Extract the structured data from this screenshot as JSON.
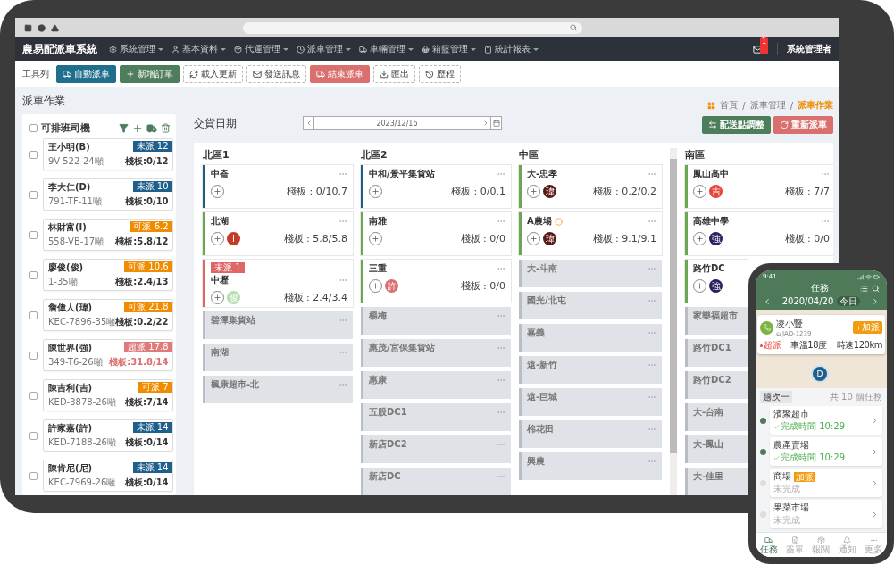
{
  "app": {
    "title": "農易配派車系統",
    "menu": [
      {
        "label": "系統管理"
      },
      {
        "label": "基本資料"
      },
      {
        "label": "代運管理"
      },
      {
        "label": "派車管理"
      },
      {
        "label": "車輛管理"
      },
      {
        "label": "箱籃管理"
      },
      {
        "label": "統計報表"
      }
    ],
    "notifications": "1",
    "user": "系統管理者"
  },
  "toolbar": {
    "label": "工具列",
    "buttons": [
      {
        "label": "自動派車",
        "kind": "primary"
      },
      {
        "label": "新增訂單",
        "kind": "success"
      },
      {
        "label": "載入更新",
        "kind": "outline"
      },
      {
        "label": "發送訊息",
        "kind": "outline"
      },
      {
        "label": "結束派車",
        "kind": "danger"
      },
      {
        "label": "匯出",
        "kind": "outline"
      },
      {
        "label": "歷程",
        "kind": "outline"
      }
    ]
  },
  "page": {
    "title": "派車作業",
    "breadcrumb": [
      {
        "label": "首頁",
        "selected": false
      },
      {
        "label": "派車管理",
        "selected": false
      },
      {
        "label": "派車作業",
        "selected": true
      }
    ],
    "breadcrumb_separators": [
      "/",
      "/"
    ]
  },
  "drivers": {
    "title": "可排班司機",
    "checked": false,
    "items": [
      {
        "name": "王小明(B)",
        "plate": "9V-522-24噸",
        "badge": "未派 12",
        "kind": "unassigned",
        "load": "棧板:0/12",
        "checked": false
      },
      {
        "name": "李大仁(D)",
        "plate": "791-TF-11噸",
        "badge": "未派 10",
        "kind": "unassigned",
        "load": "棧板:0/10",
        "checked": false
      },
      {
        "name": "林財富(I)",
        "plate": "558-VB-17噸",
        "badge": "可派 6.2",
        "kind": "available",
        "load": "棧板:5.8/12",
        "checked": false
      },
      {
        "name": "廖俊(俊)",
        "plate": "1-35噸",
        "badge": "可派 10.6",
        "kind": "available",
        "load": "棧板:2.4/13",
        "checked": false
      },
      {
        "name": "詹偉人(瑋)",
        "plate": "KEC-7896-35噸",
        "badge": "可派 21.8",
        "kind": "available",
        "load": "棧板:0.2/22",
        "checked": false
      },
      {
        "name": "陳世界(強)",
        "plate": "349-T6-26噸",
        "badge": "超派 17.8",
        "kind": "over",
        "load": "棧板:31.8/14",
        "checked": false
      },
      {
        "name": "陳吉利(吉)",
        "plate": "KED-3878-26噸",
        "badge": "可派 7",
        "kind": "available",
        "load": "棧板:7/14",
        "checked": false
      },
      {
        "name": "許家嘉(許)",
        "plate": "KED-7188-26噸",
        "badge": "未派 14",
        "kind": "unassigned",
        "load": "棧板:0/14",
        "checked": false
      },
      {
        "name": "陳肯尼(尼)",
        "plate": "KEC-7969-26噸",
        "badge": "未派 14",
        "kind": "unassigned",
        "load": "棧板:0/14",
        "checked": false
      }
    ]
  },
  "board": {
    "date_label": "交貨日期",
    "date": "2023/12/16",
    "actions": [
      {
        "label": "配送點調整",
        "kind": "success"
      },
      {
        "label": "重新派車",
        "kind": "danger"
      }
    ],
    "columns": [
      {
        "name": "北區1",
        "stops": [
          {
            "name": "中崙",
            "kind": "active",
            "color": "#1f5f8b",
            "load": "棧板 : 0/10.7"
          },
          {
            "name": "北湖",
            "kind": "active",
            "color": "#6aa84f",
            "chips": [
              {
                "label": "I",
                "color": "#c53a26"
              }
            ],
            "load": "棧板 : 5.8/5.8"
          },
          {
            "name": "中壢",
            "kind": "active",
            "color": "#e06666",
            "tag": "未派 1",
            "chips": [
              {
                "label": "俊",
                "color": "#b6e0b0"
              }
            ],
            "load": "棧板 : 2.4/3.4"
          },
          {
            "name": "碧潭集貨站",
            "kind": "idle"
          },
          {
            "name": "南湖",
            "kind": "idle"
          },
          {
            "name": "楓康超市-北",
            "kind": "idle"
          }
        ]
      },
      {
        "name": "北區2",
        "stops": [
          {
            "name": "中和/景平集貨站",
            "kind": "active",
            "color": "#1f5f8b",
            "load": "棧板 : 0/0.1"
          },
          {
            "name": "南雅",
            "kind": "active",
            "color": "#6aa84f",
            "load": "棧板 : 0/0"
          },
          {
            "name": "三重",
            "kind": "active",
            "color": "#6aa84f",
            "chips": [
              {
                "label": "許",
                "color": "#d9706e"
              }
            ],
            "load": "棧板 : 0/0"
          },
          {
            "name": "楊梅",
            "kind": "idle"
          },
          {
            "name": "惠茂/宮保集貨站",
            "kind": "idle"
          },
          {
            "name": "惠康",
            "kind": "idle"
          },
          {
            "name": "五股DC1",
            "kind": "idle"
          },
          {
            "name": "新店DC2",
            "kind": "idle"
          },
          {
            "name": "新店DC",
            "kind": "idle"
          }
        ]
      },
      {
        "name": "中區",
        "stops": [
          {
            "name": "大-忠孝",
            "kind": "active",
            "color": "#6aa84f",
            "chips": [
              {
                "label": "瑋",
                "color": "#5a1818"
              }
            ],
            "load": "棧板 : 0.2/0.2"
          },
          {
            "name": "A農場",
            "kind": "active",
            "color": "#6aa84f",
            "marked": true,
            "chips": [
              {
                "label": "瑋",
                "color": "#5a1818"
              }
            ],
            "load": "棧板 : 9.1/9.1"
          },
          {
            "name": "大-斗南",
            "kind": "idle"
          },
          {
            "name": "國光/北屯",
            "kind": "idle"
          },
          {
            "name": "嘉義",
            "kind": "idle"
          },
          {
            "name": "遠-新竹",
            "kind": "idle"
          },
          {
            "name": "遠-巨城",
            "kind": "idle"
          },
          {
            "name": "棉花田",
            "kind": "idle"
          },
          {
            "name": "興農",
            "kind": "idle"
          }
        ]
      },
      {
        "name": "南區",
        "stops": [
          {
            "name": "鳳山高中",
            "kind": "active",
            "color": "#6aa84f",
            "chips": [
              {
                "label": "吉",
                "color": "#e8453c"
              }
            ],
            "load": "棧板 : 7/7"
          },
          {
            "name": "高雄中學",
            "kind": "active",
            "color": "#6aa84f",
            "chips": [
              {
                "label": "強",
                "color": "#2a2160"
              }
            ],
            "load": "棧板 : 0/0"
          },
          {
            "name": "路竹DC",
            "kind": "active",
            "color": "#6aa84f",
            "chips": [
              {
                "label": "強",
                "color": "#2a2160"
              }
            ]
          },
          {
            "name": "家樂福超市",
            "kind": "idle"
          },
          {
            "name": "路竹DC1",
            "kind": "idle"
          },
          {
            "name": "路竹DC2",
            "kind": "idle"
          },
          {
            "name": "大-台南",
            "kind": "idle"
          },
          {
            "name": "大-鳳山",
            "kind": "idle"
          },
          {
            "name": "大-佳里",
            "kind": "idle"
          }
        ]
      }
    ]
  },
  "phone": {
    "time": "9:41",
    "title": "任務",
    "date": "2020/04/20",
    "today": "今日",
    "driver": {
      "name": "凌小豎",
      "plate": "JAD-1239",
      "add_button": "加派",
      "status": "超派",
      "temp": "車溫18度",
      "speed": "時速120km"
    },
    "marker": "D",
    "trip": "趟次一",
    "count": "共 10 個任務",
    "tasks": [
      {
        "name": "濱聚超市",
        "status": "完成時間 10:29",
        "done": true
      },
      {
        "name": "農產賣場",
        "status": "完成時間 10:29",
        "done": true
      },
      {
        "name": "商場",
        "tag": "加派",
        "status": "未完成",
        "done": false
      },
      {
        "name": "果菜市場",
        "status": "未完成",
        "done": false
      }
    ],
    "nav": [
      {
        "label": "任務",
        "selected": true
      },
      {
        "label": "簽單",
        "selected": false
      },
      {
        "label": "報關",
        "selected": false
      },
      {
        "label": "通知",
        "selected": false
      },
      {
        "label": "更多",
        "selected": false
      }
    ]
  }
}
